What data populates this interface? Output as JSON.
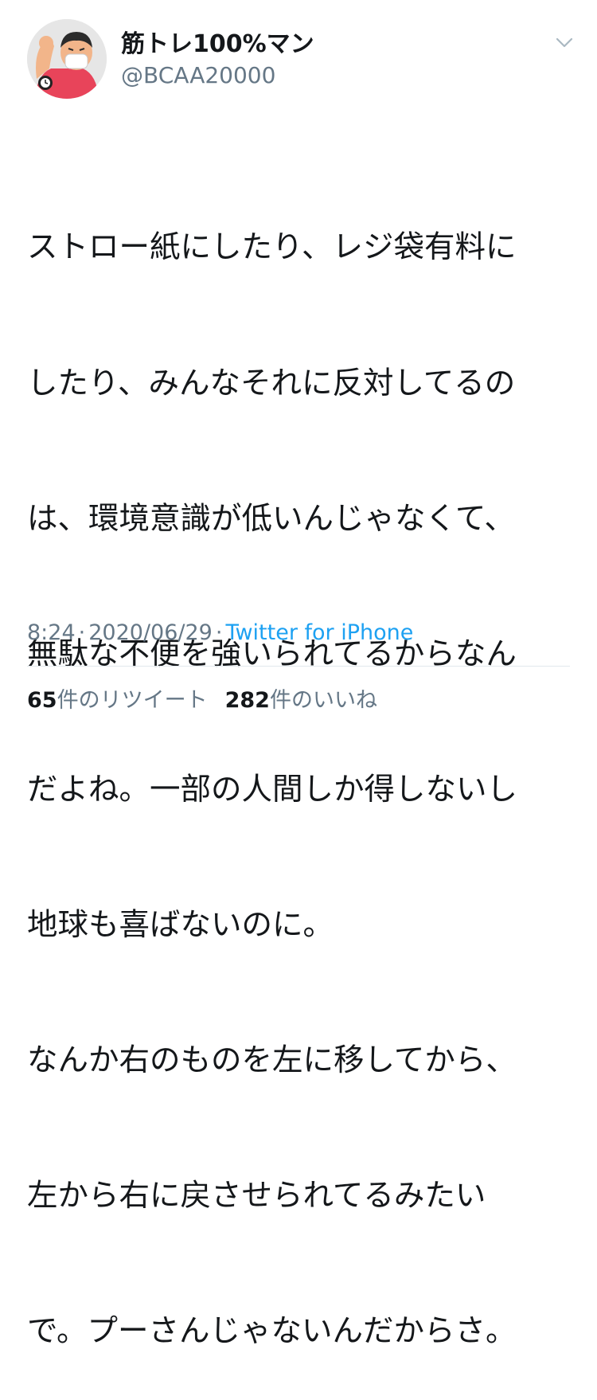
{
  "tweet": {
    "author": {
      "display_name": "筋トレ100%マン",
      "handle": "@BCAA20000",
      "avatar_icon": "avatar-muscle-man-icon"
    },
    "menu_icon": "chevron-down-icon",
    "text_lines": [
      "ストロー紙にしたり、レジ袋有料に",
      "したり、みんなそれに反対してるの",
      "は、環境意識が低いんじゃなくて、",
      "無駄な不便を強いられてるからなん",
      "だよね。一部の人間しか得しないし",
      "地球も喜ばないのに。",
      "なんか右のものを左に移してから、",
      "左から右に戻させられてるみたい",
      "で。プーさんじゃないんだからさ。"
    ],
    "time": "8:24",
    "date": "2020/06/29",
    "separator": "·",
    "client": "Twitter for iPhone",
    "retweets": {
      "count": "65",
      "label": "件のリツイート"
    },
    "likes": {
      "count": "282",
      "label": "件のいいね"
    }
  },
  "colors": {
    "text": "#14171a",
    "secondary": "#657786",
    "link": "#1da1f2",
    "divider": "#e1e8ed"
  }
}
